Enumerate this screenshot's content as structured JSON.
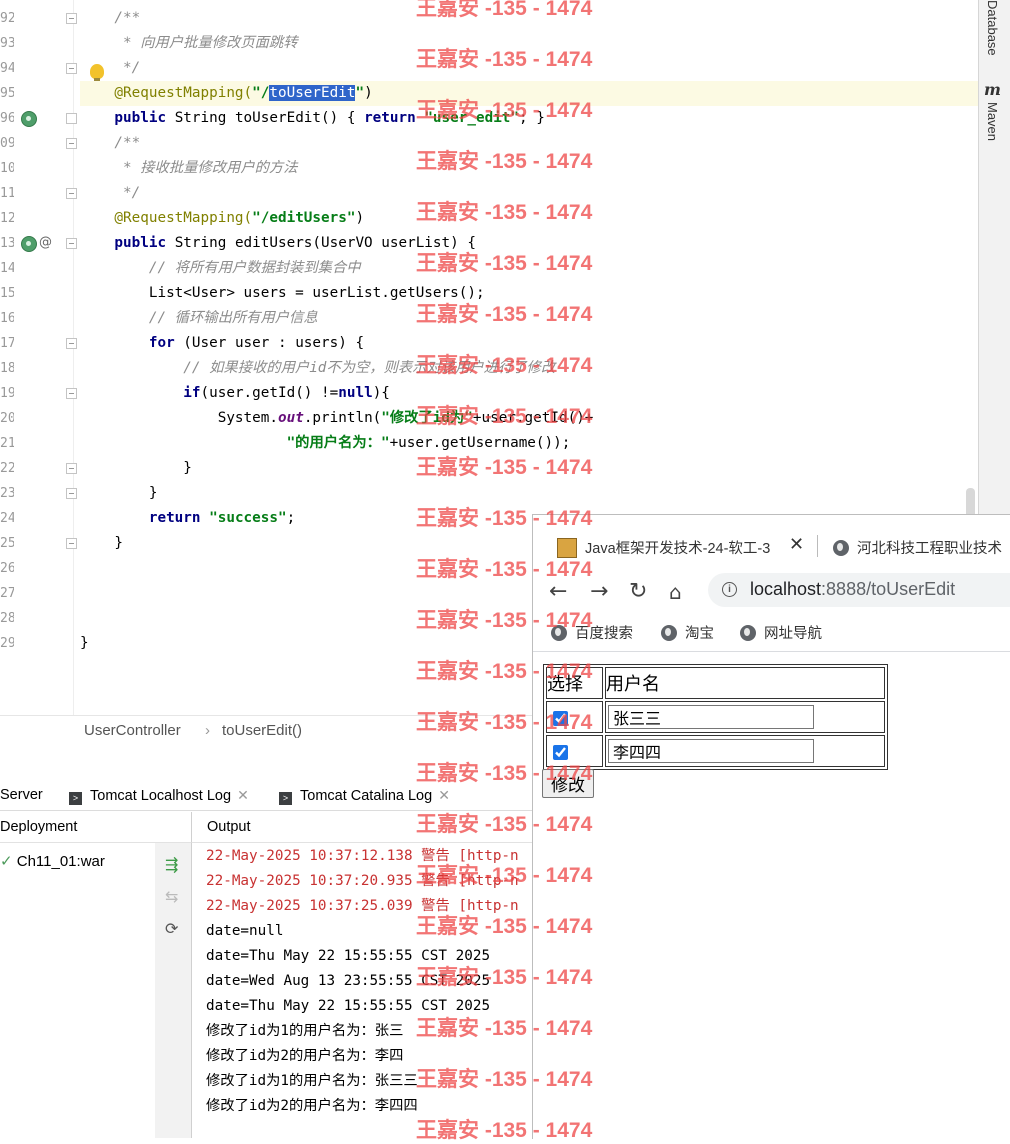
{
  "editor": {
    "gutter_numbers": [
      "92",
      "93",
      "94",
      "95",
      "96",
      "09",
      "10",
      "11",
      "12",
      "13",
      "14",
      "15",
      "16",
      "17",
      "18",
      "19",
      "20",
      "21",
      "22",
      "23",
      "24",
      "25",
      "26",
      "27",
      "28",
      "29"
    ],
    "lines": [
      [
        {
          "c": "cm",
          "t": "    /**"
        }
      ],
      [
        {
          "c": "cm",
          "t": "     * 向用户批量修改页面跳转"
        }
      ],
      [
        {
          "c": "cm",
          "t": "     */"
        }
      ],
      [
        {
          "c": "an",
          "t": "    @RequestMapping("
        },
        {
          "c": "st",
          "t": "\"/"
        },
        {
          "c": "sel",
          "t": "toUserEdit"
        },
        {
          "c": "st",
          "t": "\""
        },
        {
          "c": "",
          "t": ")"
        }
      ],
      [
        {
          "c": "kw",
          "t": "    public "
        },
        {
          "c": "",
          "t": "String toUserEdit() { "
        },
        {
          "c": "kw",
          "t": "return "
        },
        {
          "c": "st",
          "t": "\"user_edit\""
        },
        {
          "c": "",
          "t": "; }"
        }
      ],
      [
        {
          "c": "cm",
          "t": "    /**"
        }
      ],
      [
        {
          "c": "cm",
          "t": "     * 接收批量修改用户的方法"
        }
      ],
      [
        {
          "c": "cm",
          "t": "     */"
        }
      ],
      [
        {
          "c": "an",
          "t": "    @RequestMapping("
        },
        {
          "c": "st",
          "t": "\"/editUsers\""
        },
        {
          "c": "",
          "t": ")"
        }
      ],
      [
        {
          "c": "kw",
          "t": "    public "
        },
        {
          "c": "",
          "t": "String editUsers(UserVO userList) {"
        }
      ],
      [
        {
          "c": "cm",
          "t": "        // 将所有用户数据封装到集合中"
        }
      ],
      [
        {
          "c": "",
          "t": "        List<User> users = userList.getUsers();"
        }
      ],
      [
        {
          "c": "cm",
          "t": "        // 循环输出所有用户信息"
        }
      ],
      [
        {
          "c": "kw",
          "t": "        for "
        },
        {
          "c": "",
          "t": "(User user : users) {"
        }
      ],
      [
        {
          "c": "cm",
          "t": "            // 如果接收的用户id不为空，则表示对该用户进行了修改"
        }
      ],
      [
        {
          "c": "kw",
          "t": "            if"
        },
        {
          "c": "",
          "t": "(user.getId() !="
        },
        {
          "c": "kw",
          "t": "null"
        },
        {
          "c": "",
          "t": "){"
        }
      ],
      [
        {
          "c": "",
          "t": "                System."
        },
        {
          "c": "it",
          "t": "out"
        },
        {
          "c": "",
          "t": ".println("
        },
        {
          "c": "st",
          "t": "\"修改了id为\""
        },
        {
          "c": "",
          "t": "+user.getId()+"
        }
      ],
      [
        {
          "c": "st",
          "t": "                        \"的用户名为：\""
        },
        {
          "c": "",
          "t": "+user.getUsername());"
        }
      ],
      [
        {
          "c": "",
          "t": "            }"
        }
      ],
      [
        {
          "c": "",
          "t": "        }"
        }
      ],
      [
        {
          "c": "kw",
          "t": "        return "
        },
        {
          "c": "st",
          "t": "\"success\""
        },
        {
          "c": "",
          "t": ";"
        }
      ],
      [
        {
          "c": "",
          "t": "    }"
        }
      ],
      [
        {
          "c": "",
          "t": ""
        }
      ],
      [
        {
          "c": "",
          "t": ""
        }
      ],
      [
        {
          "c": "",
          "t": ""
        }
      ],
      [
        {
          "c": "",
          "t": "}"
        }
      ]
    ]
  },
  "right_strip": {
    "database": "Database",
    "maven": "Maven"
  },
  "breadcrumb": {
    "class_name": "UserController",
    "separator": "›",
    "method": "toUserEdit()"
  },
  "run": {
    "tabs": {
      "server": "Server",
      "localhost_log": "Tomcat Localhost Log",
      "catalina_log": "Tomcat Catalina Log"
    },
    "deployment_header": "Deployment",
    "output_header": "Output",
    "deployment_item": "Ch11_01:war",
    "output_lines": [
      {
        "type": "err",
        "text": "22-May-2025 10:37:12.138 警告 [http-n"
      },
      {
        "type": "err",
        "text": "22-May-2025 10:37:20.935 警告 [http-n"
      },
      {
        "type": "err",
        "text": "22-May-2025 10:37:25.039 警告 [http-n"
      },
      {
        "type": "out",
        "text": "date=null"
      },
      {
        "type": "out",
        "text": "date=Thu May 22 15:55:55 CST 2025"
      },
      {
        "type": "out",
        "text": "date=Wed Aug 13 23:55:55 CST 2025"
      },
      {
        "type": "out",
        "text": "date=Thu May 22 15:55:55 CST 2025"
      },
      {
        "type": "out",
        "text": "修改了id为1的用户名为：张三"
      },
      {
        "type": "out",
        "text": "修改了id为2的用户名为：李四"
      },
      {
        "type": "out",
        "text": "修改了id为1的用户名为：张三三"
      },
      {
        "type": "out",
        "text": "修改了id为2的用户名为：李四四"
      }
    ]
  },
  "browser": {
    "tab1_title": "Java框架开发技术-24-软工-3",
    "tab2_title": "河北科技工程职业技术",
    "url_host": "localhost",
    "url_path": ":8888/toUserEdit",
    "bookmarks": [
      "百度搜索",
      "淘宝",
      "网址导航"
    ],
    "table_headers": {
      "select": "选择",
      "username": "用户名"
    },
    "rows": [
      {
        "checked": true,
        "username": "张三三"
      },
      {
        "checked": true,
        "username": "李四四"
      }
    ],
    "submit_label": "修改"
  },
  "watermark": {
    "text": "王嘉安 -135 - 1474"
  }
}
